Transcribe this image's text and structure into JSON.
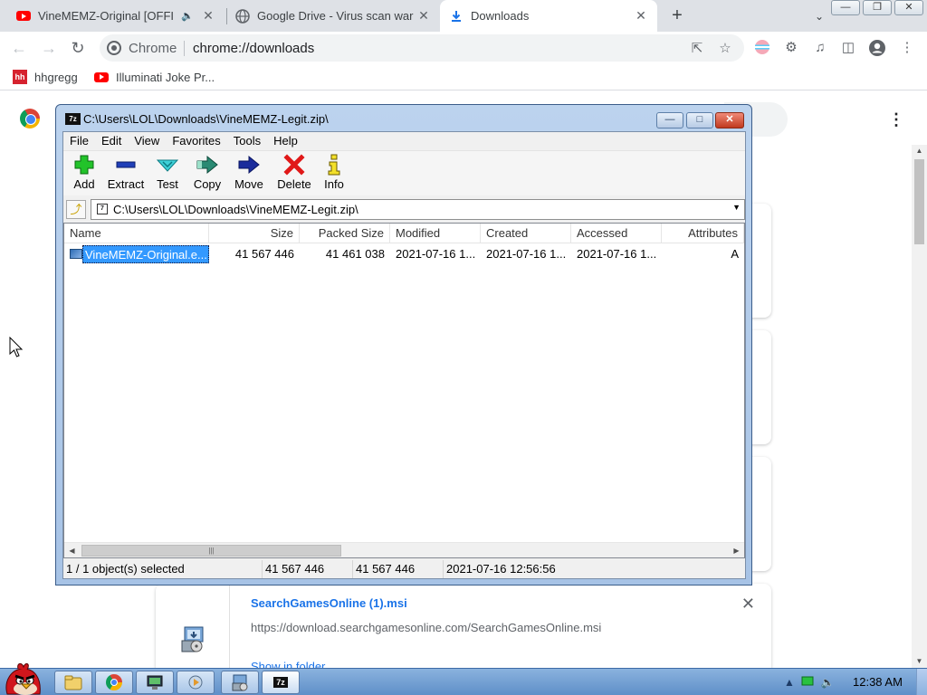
{
  "browser": {
    "tabs": [
      {
        "title": "VineMEMZ-Original [OFFI",
        "favicon": "youtube-icon",
        "audio": true
      },
      {
        "title": "Google Drive - Virus scan war",
        "favicon": "globe-icon"
      },
      {
        "title": "Downloads",
        "favicon": "download-icon",
        "active": true
      }
    ],
    "omnibox": {
      "scheme_label": "Chrome",
      "url": "chrome://downloads"
    },
    "bookmarks": [
      {
        "label": "hhgregg",
        "favicon": "hhgregg-icon"
      },
      {
        "label": "Illuminati Joke Pr...",
        "favicon": "youtube-icon"
      }
    ]
  },
  "downloads": {
    "item": {
      "filename": "SearchGamesOnline (1).msi",
      "url": "https://download.searchgamesonline.com/SearchGamesOnline.msi",
      "action": "Show in folder"
    }
  },
  "zip": {
    "title": "C:\\Users\\LOL\\Downloads\\VineMEMZ-Legit.zip\\",
    "logo": "7z",
    "menu": [
      "File",
      "Edit",
      "View",
      "Favorites",
      "Tools",
      "Help"
    ],
    "toolbar": [
      {
        "label": "Add",
        "icon": "plus-icon"
      },
      {
        "label": "Extract",
        "icon": "minus-icon"
      },
      {
        "label": "Test",
        "icon": "check-icon"
      },
      {
        "label": "Copy",
        "icon": "copy-arrow-icon"
      },
      {
        "label": "Move",
        "icon": "move-arrow-icon"
      },
      {
        "label": "Delete",
        "icon": "delete-x-icon"
      },
      {
        "label": "Info",
        "icon": "info-icon"
      }
    ],
    "address": "C:\\Users\\LOL\\Downloads\\VineMEMZ-Legit.zip\\",
    "columns": [
      "Name",
      "Size",
      "Packed Size",
      "Modified",
      "Created",
      "Accessed",
      "Attributes"
    ],
    "rows": [
      {
        "name": "VineMEMZ-Original.e...",
        "size": "41 567 446",
        "packed": "41 461 038",
        "modified": "2021-07-16 1...",
        "created": "2021-07-16 1...",
        "accessed": "2021-07-16 1...",
        "attributes": "A"
      }
    ],
    "status": {
      "selected": "1 / 1 object(s) selected",
      "size": "41 567 446",
      "packed": "41 567 446",
      "date": "2021-07-16 12:56:56"
    }
  },
  "taskbar": {
    "clock": "12:38 AM"
  },
  "colors": {
    "accent": "#1a73e8",
    "selection": "#3399ff",
    "youtube": "#ff0000",
    "taskbar": "#6e9bd2"
  }
}
